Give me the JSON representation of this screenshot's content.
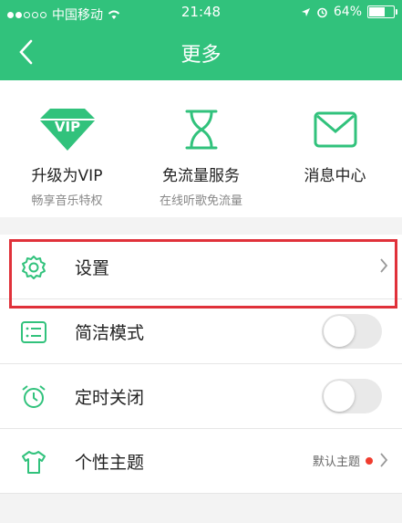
{
  "status_bar": {
    "carrier": "中国移动",
    "time": "21:48",
    "battery": "64%",
    "battery_level": 0.64
  },
  "nav": {
    "title": "更多",
    "back_icon": "chevron-left-icon"
  },
  "features": [
    {
      "label": "升级为VIP",
      "sub": "畅享音乐特权",
      "icon": "vip-diamond-icon",
      "badge": "VIP"
    },
    {
      "label": "免流量服务",
      "sub": "在线听歌免流量",
      "icon": "hourglass-icon"
    },
    {
      "label": "消息中心",
      "sub": "",
      "icon": "mail-icon"
    }
  ],
  "rows": [
    {
      "label": "设置",
      "icon": "gear-icon"
    },
    {
      "label": "简洁模式",
      "icon": "list-icon",
      "toggle_on": false
    },
    {
      "label": "定时关闭",
      "icon": "alarm-clock-icon",
      "toggle_on": false
    },
    {
      "label": "个性主题",
      "icon": "tshirt-icon",
      "value": "默认主题"
    }
  ],
  "colors": {
    "brand": "#31c27c",
    "highlight": "#e0313a",
    "dot": "#f03c2e"
  }
}
